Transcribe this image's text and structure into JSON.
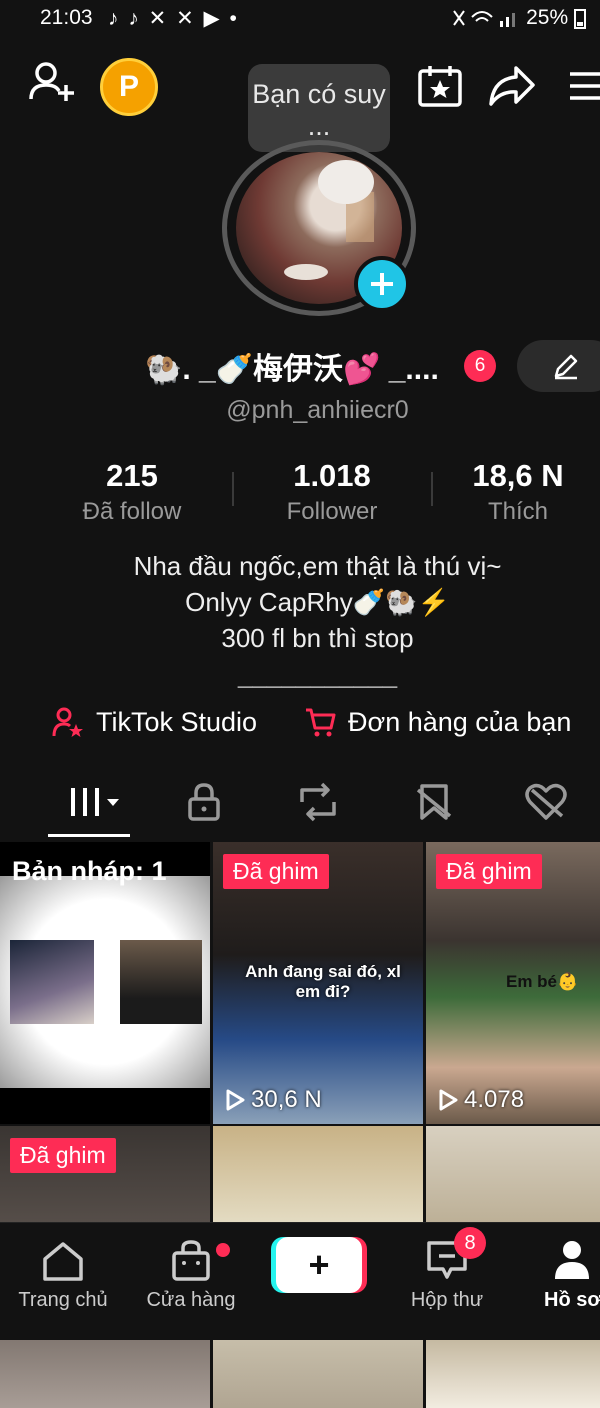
{
  "status_bar": {
    "time": "21:03",
    "app_icons": "♪ ♪ ✕ ✕ ▶ •",
    "battery": "25%"
  },
  "coin": {
    "label": "P"
  },
  "tooltip": {
    "text": "Bạn có suy ..."
  },
  "profile": {
    "display_name": "🐏. _🍼梅伊沃💕 _....",
    "name_badge": "6",
    "handle": "@pnh_anhiiecr0",
    "stats": [
      {
        "value": "215",
        "label": "Đã follow"
      },
      {
        "value": "1.018",
        "label": "Follower"
      },
      {
        "value": "18,6 N",
        "label": "Thích"
      }
    ],
    "bio_lines": [
      "Nha đầu ngốc,em thật là thú vị~",
      "Onlyy CapRhy🍼🐏⚡",
      "300 fl bn thì stop",
      "___________"
    ]
  },
  "links": {
    "studio": "TikTok Studio",
    "orders": "Đơn hàng của bạn"
  },
  "grid": {
    "draft_label": "Bản nháp: 1",
    "items": [
      {
        "pin": "Đã ghim",
        "caption": "Anh đang sai đó, xl em đi?",
        "views": "30,6 N"
      },
      {
        "pin": "Đã ghim",
        "caption": "Em bé👶",
        "views": "4.078"
      },
      {
        "pin": "Đã ghim"
      }
    ]
  },
  "bottom_nav": {
    "home": "Trang chủ",
    "shop": "Cửa hàng",
    "create": "+",
    "inbox": "Hộp thư",
    "inbox_badge": "8",
    "profile": "Hồ sơ"
  },
  "colors": {
    "accent": "#fe2c55",
    "cyan": "#25f4ee",
    "background": "#121212"
  }
}
